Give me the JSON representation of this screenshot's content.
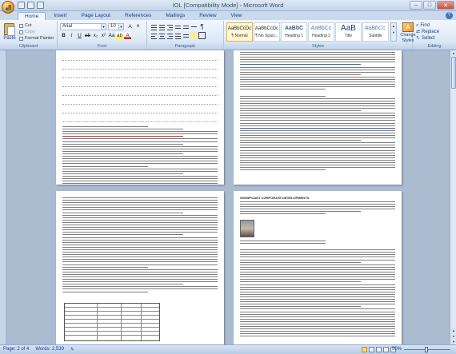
{
  "window": {
    "title": "IOL [Compatibility Mode] - Microsoft Word"
  },
  "tabs": [
    "Home",
    "Insert",
    "Page Layout",
    "References",
    "Mailings",
    "Review",
    "View"
  ],
  "active_tab": "Home",
  "ribbon": {
    "clipboard": {
      "paste_label": "Paste",
      "cut_label": "Cut",
      "copy_label": "Copy",
      "format_painter_label": "Format Painter",
      "group_label": "Clipboard"
    },
    "font": {
      "font_name": "Arial",
      "font_size": "10",
      "group_label": "Font"
    },
    "paragraph": {
      "group_label": "Paragraph"
    },
    "styles": {
      "items": [
        {
          "sample": "AaBbCcDc",
          "name": "¶ Normal",
          "selected": true
        },
        {
          "sample": "AaBbCcDc",
          "name": "¶ No Spaci..."
        },
        {
          "sample": "AaBbC",
          "name": "Heading 1"
        },
        {
          "sample": "AaBbCc",
          "name": "Heading 2"
        },
        {
          "sample": "AaB",
          "name": "Title"
        },
        {
          "sample": "AaBbCc.",
          "name": "Subtitle"
        }
      ],
      "change_styles_label": "Change Styles",
      "group_label": "Styles"
    },
    "editing": {
      "find_label": "Find",
      "replace_label": "Replace",
      "select_label": "Select",
      "group_label": "Editing"
    }
  },
  "statusbar": {
    "page": "Page: 2 of 4",
    "words": "Words: 2,539",
    "zoom": "50%"
  },
  "page4": {
    "heading": "SIGNIFICANT CORPORATE DEVELOPMENTS"
  }
}
